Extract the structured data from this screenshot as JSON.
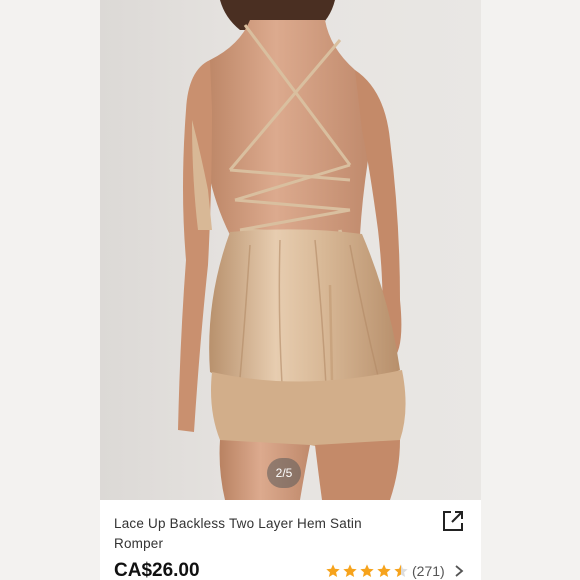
{
  "gallery": {
    "page_indicator": "2/5",
    "image_subject": "back-view-satin-romper-photo"
  },
  "product": {
    "title": "Lace Up Backless Two Layer Hem Satin Romper",
    "price": "CA$26.00",
    "rating_value": 4.5,
    "rating_count": "(271)"
  },
  "icons": {
    "share": "share-icon",
    "star": "star-icon",
    "chevron": "chevron-right-icon"
  },
  "colors": {
    "star": "#f6a31c",
    "satin": "#d9b895",
    "skin": "#d6a488"
  }
}
